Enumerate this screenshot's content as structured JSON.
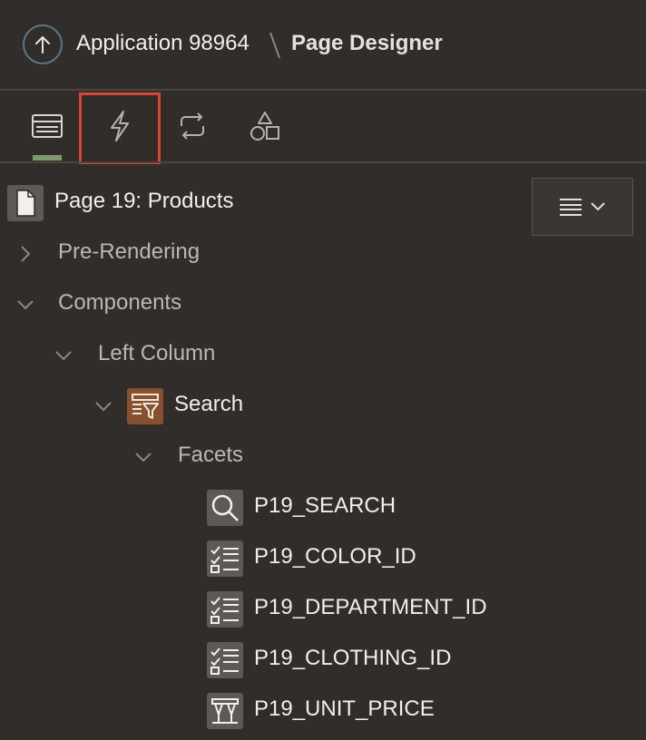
{
  "header": {
    "app_label": "Application 98964",
    "page_title": "Page Designer"
  },
  "tabs": [
    {
      "icon": "rendering-tree-icon",
      "active": true
    },
    {
      "icon": "dynamic-actions-lightning-icon",
      "highlighted": true
    },
    {
      "icon": "processing-icon"
    },
    {
      "icon": "shared-components-icon"
    }
  ],
  "tree": {
    "page": "Page 19: Products",
    "nodes": {
      "pre_rendering": "Pre-Rendering",
      "components": "Components",
      "left_column": "Left Column",
      "search": "Search",
      "facets": "Facets",
      "items": [
        {
          "label": "P19_SEARCH",
          "icon": "search-facet-icon"
        },
        {
          "label": "P19_COLOR_ID",
          "icon": "checkbox-facet-icon"
        },
        {
          "label": "P19_DEPARTMENT_ID",
          "icon": "checkbox-facet-icon"
        },
        {
          "label": "P19_CLOTHING_ID",
          "icon": "checkbox-facet-icon"
        },
        {
          "label": "P19_UNIT_PRICE",
          "icon": "range-facet-icon"
        }
      ]
    }
  },
  "colors": {
    "background": "#312d2a",
    "active_tab": "#7d9b6a",
    "highlight": "#e0432e",
    "search_region_icon": "#87512f"
  }
}
